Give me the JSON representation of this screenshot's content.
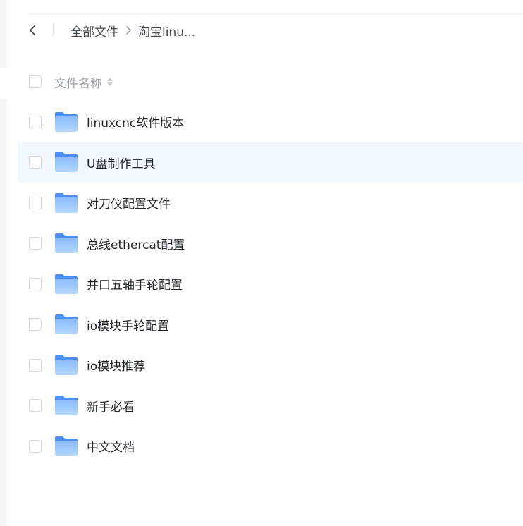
{
  "breadcrumb": {
    "root_label": "全部文件",
    "current_label": "淘宝linu..."
  },
  "header": {
    "name_column_label": "文件名称"
  },
  "files": [
    {
      "name": "linuxcnc软件版本"
    },
    {
      "name": "U盘制作工具"
    },
    {
      "name": "对刀仪配置文件"
    },
    {
      "name": "总线ethercat配置"
    },
    {
      "name": "并口五轴手轮配置"
    },
    {
      "name": "io模块手轮配置"
    },
    {
      "name": "io模块推荐"
    },
    {
      "name": "新手必看"
    },
    {
      "name": "中文文档"
    }
  ],
  "colors": {
    "hover_row": "#f2f8ff",
    "folder_top": "#4b8ff7",
    "folder_body_light": "#a9d1ff",
    "folder_body_dark": "#6ea9fb"
  }
}
